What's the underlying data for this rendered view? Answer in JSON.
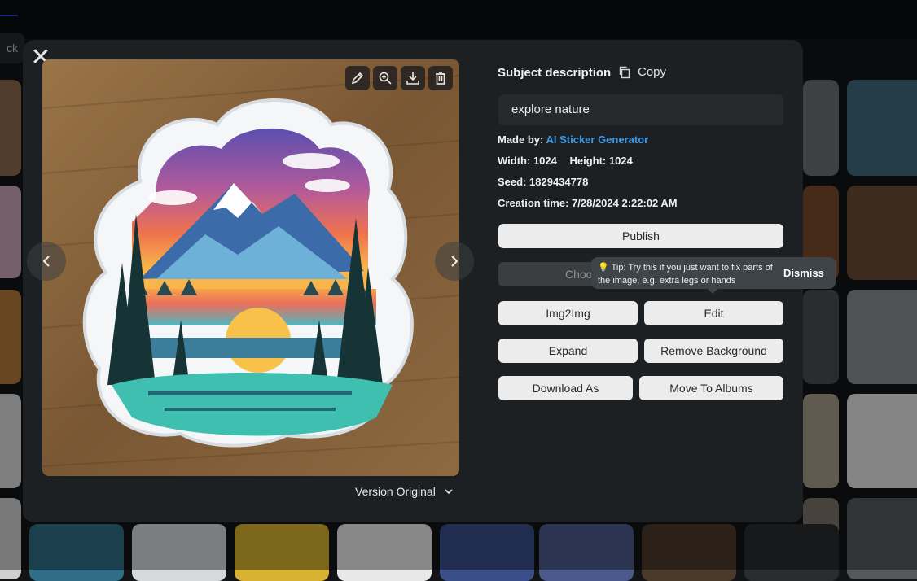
{
  "background": {
    "back_label": "ck"
  },
  "modal": {
    "close_label": "✕",
    "image_tools": [
      "edit-pencil-icon",
      "zoom-in-icon",
      "download-icon",
      "trash-icon"
    ],
    "version_label": "Version Original",
    "subject_heading": "Subject description",
    "copy_label": "Copy",
    "description": "explore nature",
    "made_by_label": "Made by:",
    "made_by_value": "AI Sticker Generator",
    "width_label": "Width:",
    "width_value": "1024",
    "height_label": "Height:",
    "height_value": "1024",
    "seed_label": "Seed:",
    "seed_value": "1829434778",
    "creation_label": "Creation time:",
    "creation_value": "7/28/2024 2:22:02 AM",
    "buttons": {
      "publish": "Publish",
      "choose_partial": "Choo",
      "img2img": "Img2Img",
      "edit": "Edit",
      "expand": "Expand",
      "remove_background": "Remove Background",
      "download_as": "Download As",
      "move_to_albums": "Move To Albums"
    },
    "tip": {
      "icon": "💡",
      "text": "Tip: Try this if you just want to fix parts of the image, e.g. extra legs or hands",
      "dismiss": "Dismiss"
    }
  },
  "colors": {
    "accent_link": "#3f9ae6",
    "modal_bg": "#1c2022",
    "button_bg": "#ececec"
  }
}
